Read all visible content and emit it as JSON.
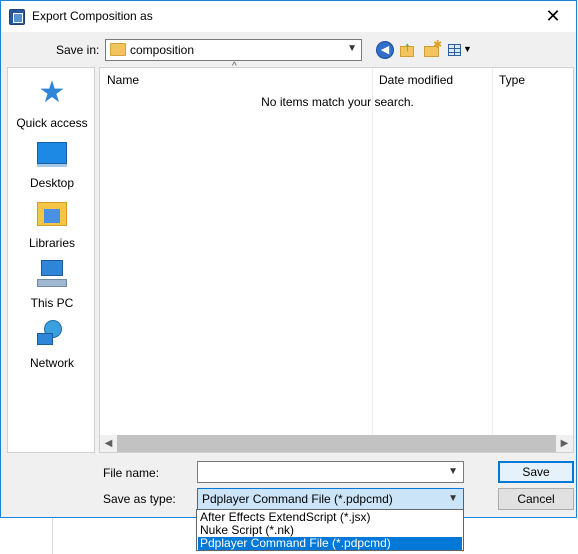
{
  "window": {
    "title": "Export Composition as",
    "close_glyph": "✕"
  },
  "toolbar": {
    "save_in_label": "Save in:",
    "save_in_value": "composition",
    "icons": [
      "back-icon",
      "up-folder-icon",
      "new-folder-icon",
      "view-menu-icon"
    ]
  },
  "places": [
    {
      "label": "Quick access",
      "icon": "star-icon"
    },
    {
      "label": "Desktop",
      "icon": "desktop-icon"
    },
    {
      "label": "Libraries",
      "icon": "libraries-icon"
    },
    {
      "label": "This PC",
      "icon": "computer-icon"
    },
    {
      "label": "Network",
      "icon": "network-icon"
    }
  ],
  "filelist": {
    "columns": [
      "Name",
      "Date modified",
      "Type"
    ],
    "sort_glyph": "^",
    "empty_message": "No items match your search."
  },
  "form": {
    "file_name_label": "File name:",
    "file_name_value": "",
    "save_type_label": "Save as type:",
    "save_type_value": "Pdplayer Command File (*.pdpcmd)",
    "type_options": [
      "After Effects ExtendScript (*.jsx)",
      "Nuke Script (*.nk)",
      "Pdplayer Command File (*.pdpcmd)"
    ],
    "selected_option_index": 2
  },
  "buttons": {
    "save": "Save",
    "cancel": "Cancel"
  },
  "colors": {
    "accent": "#0078d7",
    "window_border": "#1883d7",
    "dialog_bg": "#f0f0f0"
  }
}
